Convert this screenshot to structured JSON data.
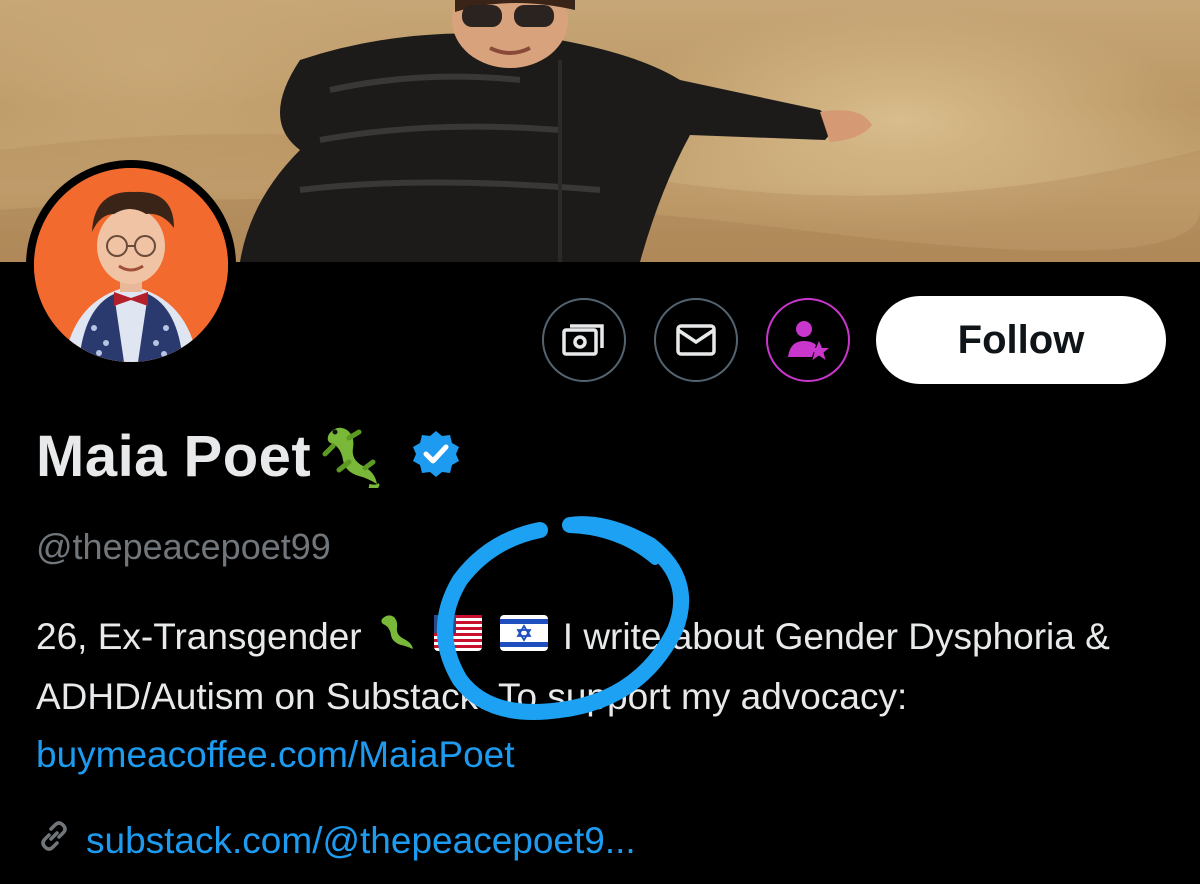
{
  "profile": {
    "name": "Maia Poet",
    "handle": "@thepeacepoet99",
    "bio": {
      "text_before": "26, Ex-Transgender",
      "text_after": "I write about Gender Dysphoria & ADHD/Autism on Substack. To support my advocacy:",
      "link": "buymeacoffee.com/MaiaPoet"
    },
    "website": "substack.com/@thepeacepoet9..."
  },
  "actions": {
    "follow_label": "Follow"
  },
  "icons": {
    "tip": "money-icon",
    "message": "envelope-icon",
    "subscribe": "person-star-icon",
    "verified": "verified-badge-icon",
    "link": "link-icon"
  },
  "colors": {
    "accent_blue": "#1d9bf0",
    "subscribe_purple": "#c936cc",
    "annotation_circle": "#1da1f2"
  }
}
